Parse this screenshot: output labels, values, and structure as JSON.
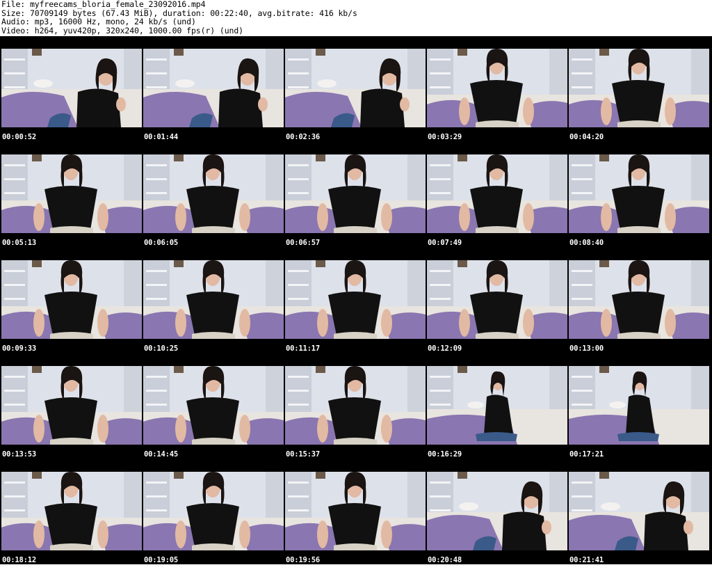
{
  "header": {
    "file_line": "File: myfreecams_bloria_female_23092016.mp4",
    "size_line": "Size: 70709149 bytes (67.43 MiB), duration: 00:22:40, avg.bitrate: 416 kb/s",
    "audio_line": "Audio: mp3, 16000 Hz, mono, 24 kb/s (und)",
    "video_line": "Video: h264, yuv420p, 320x240, 1000.00 fps(r) (und)"
  },
  "thumbnails": [
    {
      "timestamp": "00:00:52",
      "pose": "lean"
    },
    {
      "timestamp": "00:01:44",
      "pose": "lean"
    },
    {
      "timestamp": "00:02:36",
      "pose": "lean"
    },
    {
      "timestamp": "00:03:29",
      "pose": "sit"
    },
    {
      "timestamp": "00:04:20",
      "pose": "sit"
    },
    {
      "timestamp": "00:05:13",
      "pose": "sit"
    },
    {
      "timestamp": "00:06:05",
      "pose": "sit"
    },
    {
      "timestamp": "00:06:57",
      "pose": "sit"
    },
    {
      "timestamp": "00:07:49",
      "pose": "sit"
    },
    {
      "timestamp": "00:08:40",
      "pose": "sit"
    },
    {
      "timestamp": "00:09:33",
      "pose": "sit"
    },
    {
      "timestamp": "00:10:25",
      "pose": "sit"
    },
    {
      "timestamp": "00:11:17",
      "pose": "sit"
    },
    {
      "timestamp": "00:12:09",
      "pose": "sit"
    },
    {
      "timestamp": "00:13:00",
      "pose": "sit"
    },
    {
      "timestamp": "00:13:53",
      "pose": "sit"
    },
    {
      "timestamp": "00:14:45",
      "pose": "sit"
    },
    {
      "timestamp": "00:15:37",
      "pose": "sit"
    },
    {
      "timestamp": "00:16:29",
      "pose": "far"
    },
    {
      "timestamp": "00:17:21",
      "pose": "far"
    },
    {
      "timestamp": "00:18:12",
      "pose": "sit"
    },
    {
      "timestamp": "00:19:05",
      "pose": "sit"
    },
    {
      "timestamp": "00:19:56",
      "pose": "sit"
    },
    {
      "timestamp": "00:20:48",
      "pose": "lean"
    },
    {
      "timestamp": "00:21:41",
      "pose": "lean"
    }
  ],
  "colors": {
    "wall": "#dde1ea",
    "shelf": "#c9ced8",
    "blanket": "#8a76b0",
    "sheet": "#e8e4df",
    "shirt": "#111111",
    "hair": "#1a1412",
    "skin": "#e2b9a3",
    "jeans": "#3a5a8a"
  }
}
